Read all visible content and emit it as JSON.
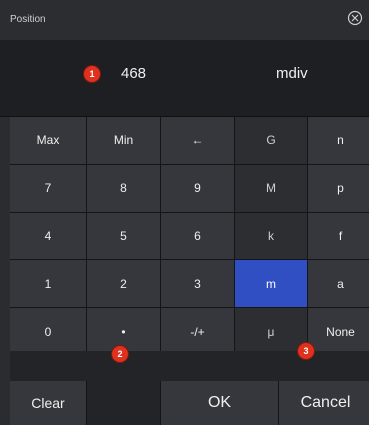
{
  "dialog": {
    "title": "Position"
  },
  "display": {
    "value": "468",
    "unit": "mdiv",
    "badge": "1"
  },
  "badges": {
    "b2": "2",
    "b3": "3"
  },
  "keys": [
    [
      "Max",
      "Min",
      "←",
      "G",
      "n"
    ],
    [
      "7",
      "8",
      "9",
      "M",
      "p"
    ],
    [
      "4",
      "5",
      "6",
      "k",
      "f"
    ],
    [
      "1",
      "2",
      "3",
      "m",
      "a"
    ],
    [
      "0",
      "•",
      "-/+",
      "μ",
      "None"
    ]
  ],
  "selected_unit": "m",
  "actions": {
    "clear": "Clear",
    "ok": "OK",
    "cancel": "Cancel"
  },
  "colors": {
    "selected": "#2f4fc2",
    "badge": "#e0301e",
    "background": "#2a2c30"
  }
}
